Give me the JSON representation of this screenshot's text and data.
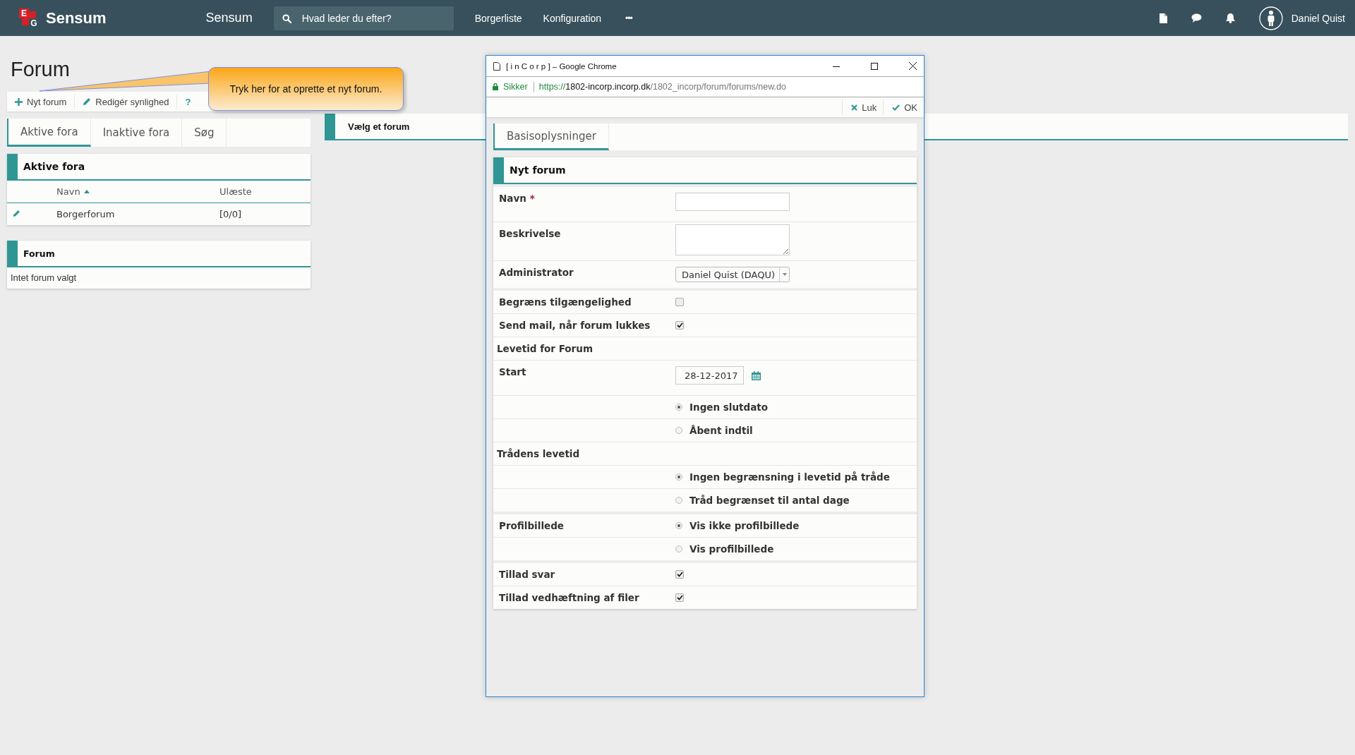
{
  "topbar": {
    "logo": {
      "letters": [
        "E",
        "G"
      ],
      "name": "Sensum"
    },
    "app_title": "Sensum",
    "search": {
      "placeholder": "Hvad leder du efter?"
    },
    "nav": [
      "Borgerliste",
      "Konfiguration"
    ],
    "more": "•••",
    "user": "Daniel Quist"
  },
  "page": {
    "title": "Forum",
    "toolbar": [
      {
        "label": "Nyt forum",
        "kind": "plus"
      },
      {
        "label": "Redigér synlighed",
        "kind": "pencil"
      },
      {
        "label": "?",
        "kind": "help"
      }
    ],
    "tabs": [
      {
        "label": "Aktive fora",
        "selected": true
      },
      {
        "label": "Inaktive fora",
        "selected": false
      },
      {
        "label": "Søg",
        "selected": false
      }
    ],
    "active_panel": {
      "title": "Aktive fora",
      "columns": [
        {
          "label": "Navn",
          "sorted": true
        },
        {
          "label": "Ulæste",
          "sorted": false
        }
      ],
      "rows": [
        {
          "name": "Borgerforum",
          "unread": "[0/0]"
        }
      ]
    },
    "forum_panel": {
      "title": "Forum",
      "empty_text": "Intet forum valgt"
    },
    "detail_panel": {
      "title": "Vælg et forum"
    },
    "callout": {
      "text": "Tryk her for at oprette et nyt forum."
    }
  },
  "popup": {
    "title": "[ i n C o r p ] – Google Chrome",
    "secure_label": "Sikker",
    "url_scheme": "https://",
    "url_host": "1802-incorp.incorp.dk",
    "url_path": "/1802_incorp/forum/forums/new.do",
    "actions": [
      {
        "label": "Luk",
        "kind": "close"
      },
      {
        "label": "OK",
        "kind": "check"
      }
    ],
    "tabs": [
      {
        "label": "Basisoplysninger",
        "selected": true
      }
    ],
    "form_title": "Nyt forum",
    "groups": [
      [
        {
          "kind": "text",
          "label": "Navn",
          "required_mark": "*"
        },
        {
          "kind": "textarea",
          "label": "Beskrivelse"
        },
        {
          "kind": "select",
          "label": "Administrator",
          "value": "Daniel Quist (DAQU)"
        }
      ],
      [
        {
          "kind": "checkbox",
          "label": "Begræns tilgængelighed",
          "checked": false
        },
        {
          "kind": "checkbox",
          "label": "Send mail, når forum lukkes",
          "checked": true
        },
        {
          "kind": "section",
          "label": "Levetid for Forum"
        },
        {
          "kind": "date",
          "label": "Start",
          "value": "28-12-2017"
        },
        {
          "kind": "radio",
          "option": "Ingen slutdato",
          "selected": true
        },
        {
          "kind": "radio",
          "option": "Åbent indtil",
          "selected": false
        },
        {
          "kind": "section",
          "label": "Trådens levetid"
        },
        {
          "kind": "radio",
          "option": "Ingen begrænsning i levetid på tråde",
          "selected": true
        },
        {
          "kind": "radio",
          "option": "Tråd begrænset til antal dage",
          "selected": false
        }
      ],
      [
        {
          "kind": "radio",
          "label": "Profilbillede",
          "option": "Vis ikke profilbillede",
          "selected": true
        },
        {
          "kind": "radio",
          "option": "Vis profilbillede",
          "selected": false
        }
      ],
      [
        {
          "kind": "checkbox",
          "label": "Tillad svar",
          "checked": true
        },
        {
          "kind": "checkbox",
          "label": "Tillad vedhæftning af filer",
          "checked": true
        }
      ]
    ]
  }
}
